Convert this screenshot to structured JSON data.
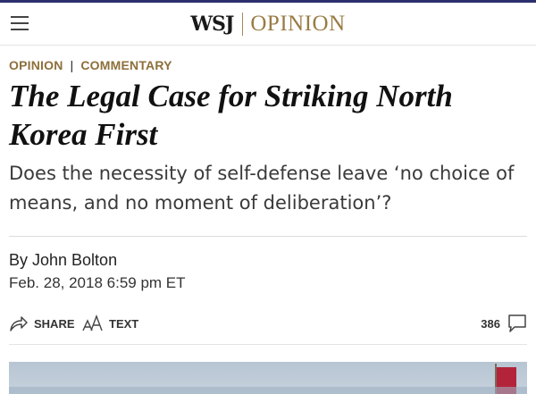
{
  "header": {
    "brand": "WSJ",
    "section": "OPINION",
    "menu_icon": "hamburger-menu-icon"
  },
  "article": {
    "kicker_section": "OPINION",
    "kicker_separator": "|",
    "kicker_category": "COMMENTARY",
    "headline": "The Legal Case for Striking North Korea First",
    "dek": "Does the necessity of self-defense leave ‘no choice of means, and no moment of deliberation’?",
    "byline": "By John Bolton",
    "dateline": "Feb. 28, 2018 6:59 pm ET"
  },
  "toolbar": {
    "share_label": "SHARE",
    "share_icon": "share-arrow-icon",
    "text_label": "TEXT",
    "text_icon": "text-size-icon",
    "comment_count": "386",
    "comment_icon": "comment-bubble-icon"
  },
  "image": {
    "icon": "hero-photo",
    "flag_color": "#b3243a"
  },
  "colors": {
    "accent_gold": "#9a7b45",
    "kicker_gold": "#8d6f3b",
    "top_bar": "#2b2f6e"
  }
}
